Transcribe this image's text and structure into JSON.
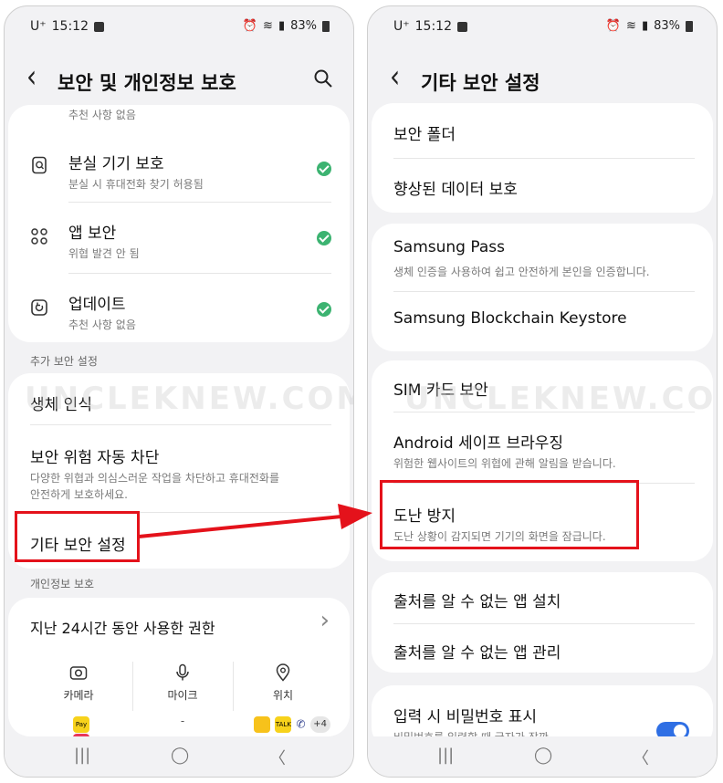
{
  "status_bar": {
    "carrier": "U⁺",
    "time": "15:12",
    "battery": "83%"
  },
  "left": {
    "title": "보안 및 개인정보 보호",
    "top_card": {
      "partial_sub": "추천 사항 없음",
      "items": [
        {
          "label": "분실 기기 보호",
          "sub": "분실 시 휴대전화 찾기 허용됨"
        },
        {
          "label": "앱 보안",
          "sub": "위협 발견 안 됨"
        },
        {
          "label": "업데이트",
          "sub": "추천 사항 없음"
        }
      ]
    },
    "section_extra": "추가 보안 설정",
    "extra_card": {
      "biometrics": "생체 인식",
      "auto_block": {
        "label": "보안 위험 자동 차단",
        "sub1": "다양한 위협과 의심스러운 작업을 차단하고 휴대전화를",
        "sub2": "안전하게 보호하세요."
      },
      "other_settings": "기타 보안 설정"
    },
    "section_privacy": "개인정보 보호",
    "privacy_card": {
      "permissions_label": "지난 24시간 동안 사용한 권한",
      "tiles": [
        {
          "label": "카메라"
        },
        {
          "label": "마이크",
          "apps": "-"
        },
        {
          "label": "위치",
          "more": "+4"
        }
      ],
      "app_badges": {
        "pay": "Pay",
        "talk": "TALK"
      }
    }
  },
  "right": {
    "title": "기타 보안 설정",
    "card1": {
      "secure_folder": "보안 폴더",
      "enhanced_data": "향상된 데이터 보호"
    },
    "card2": {
      "samsung_pass": "Samsung Pass",
      "samsung_pass_sub": "생체 인증을 사용하여 쉽고 안전하게 본인을 인증합니다.",
      "blockchain": "Samsung Blockchain Keystore"
    },
    "card3": {
      "sim": "SIM 카드 보안",
      "safe_browsing": "Android 세이프 브라우징",
      "safe_browsing_sub": "위험한 웹사이트의 위협에 관해 알림을 받습니다.",
      "theft": "도난 방지",
      "theft_sub": "도난 상황이 감지되면 기기의 화면을 잠급니다."
    },
    "card4": {
      "install_unknown": "출처를 알 수 없는 앱 설치",
      "manage_unknown": "출처를 알 수 없는 앱 관리"
    },
    "card5": {
      "show_password": "입력 시 비밀번호 표시",
      "show_password_sub": "비밀번호를 입력할 때 글자가 잠깐"
    }
  },
  "watermark": "UNCLEKNEW.COM",
  "nav": {
    "recents": "|||",
    "home": "◯",
    "back": "〈"
  },
  "colors": {
    "accent": "#2f6fe4",
    "highlight": "#e4121b",
    "check": "#3cb371"
  }
}
